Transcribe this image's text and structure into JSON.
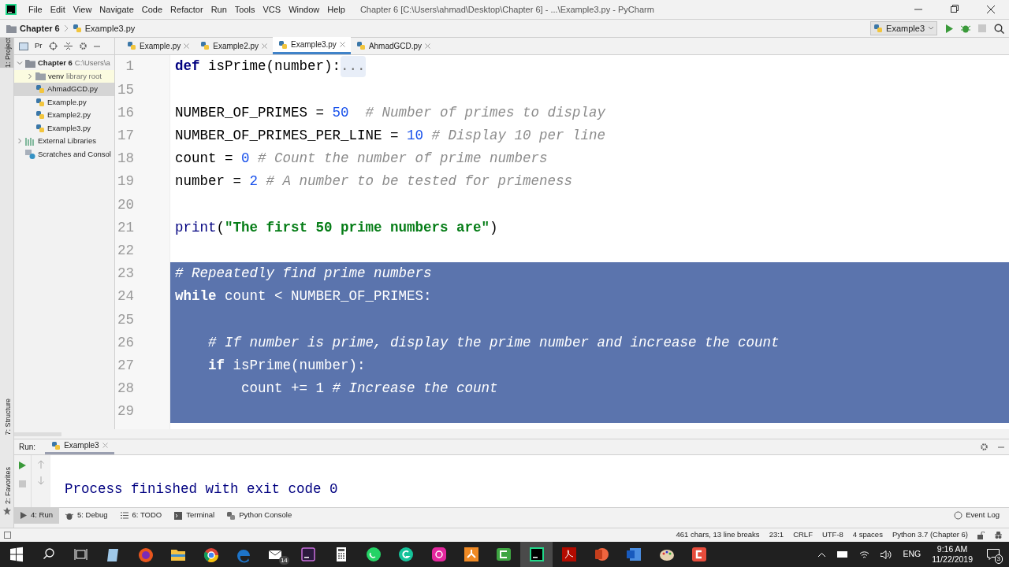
{
  "window": {
    "title": "Chapter 6 [C:\\Users\\ahmad\\Desktop\\Chapter 6] - ...\\Example3.py - PyCharm",
    "menu": [
      "File",
      "Edit",
      "View",
      "Navigate",
      "Code",
      "Refactor",
      "Run",
      "Tools",
      "VCS",
      "Window",
      "Help"
    ]
  },
  "breadcrumb": [
    "Chapter 6",
    "Example3.py"
  ],
  "run_config": "Example3",
  "side_strip": [
    {
      "label": "1: Project",
      "selected": true
    },
    {
      "label": "7: Structure",
      "selected": false
    },
    {
      "label": "2: Favorites",
      "selected": false
    }
  ],
  "project_panel": {
    "header": "Pr",
    "tree": [
      {
        "label": "Chapter 6",
        "hint": "C:\\Users\\a",
        "kind": "folder",
        "expanded": true,
        "selected": false,
        "children": [
          {
            "label": "venv",
            "hint": "library root",
            "kind": "venv",
            "expanded": false,
            "selected": false
          },
          {
            "label": "AhmadGCD.py",
            "kind": "file",
            "selected": true
          },
          {
            "label": "Example.py",
            "kind": "file",
            "selected": false
          },
          {
            "label": "Example2.py",
            "kind": "file",
            "selected": false
          },
          {
            "label": "Example3.py",
            "kind": "file",
            "selected": false
          }
        ]
      },
      {
        "label": "External Libraries",
        "kind": "libraries",
        "expanded": false,
        "selected": false
      },
      {
        "label": "Scratches and Consol",
        "kind": "scratches",
        "selected": false
      }
    ]
  },
  "editor_tabs": [
    {
      "label": "Example.py",
      "selected": false
    },
    {
      "label": "Example2.py",
      "selected": false
    },
    {
      "label": "Example3.py",
      "selected": true
    },
    {
      "label": "AhmadGCD.py",
      "selected": false
    }
  ],
  "editor_lines": [
    {
      "number": "1",
      "selected": false,
      "tokens": [
        {
          "kind": "keyword",
          "text": "def"
        },
        {
          "kind": "plain",
          "text": " isPrime(number):"
        },
        {
          "kind": "fold",
          "text": "..."
        }
      ]
    },
    {
      "number": "15",
      "selected": false
    },
    {
      "number": "16",
      "selected": false,
      "tokens": [
        {
          "kind": "plain",
          "text": "NUMBER_OF_PRIMES = "
        },
        {
          "kind": "number",
          "text": "50"
        },
        {
          "kind": "comment",
          "text": "  # Number of primes to display"
        }
      ]
    },
    {
      "number": "17",
      "selected": false,
      "tokens": [
        {
          "kind": "plain",
          "text": "NUMBER_OF_PRIMES_PER_LINE = "
        },
        {
          "kind": "number",
          "text": "10"
        },
        {
          "kind": "comment",
          "text": " # Display 10 per line"
        }
      ]
    },
    {
      "number": "18",
      "selected": false,
      "tokens": [
        {
          "kind": "plain",
          "text": "count = "
        },
        {
          "kind": "number",
          "text": "0"
        },
        {
          "kind": "comment",
          "text": " # Count the number of prime numbers"
        }
      ]
    },
    {
      "number": "19",
      "selected": false,
      "tokens": [
        {
          "kind": "plain",
          "text": "number = "
        },
        {
          "kind": "number",
          "text": "2"
        },
        {
          "kind": "comment",
          "text": " # A number to be tested for primeness"
        }
      ]
    },
    {
      "number": "20",
      "selected": false
    },
    {
      "number": "21",
      "selected": false,
      "tokens": [
        {
          "kind": "builtin",
          "text": "print"
        },
        {
          "kind": "plain",
          "text": "("
        },
        {
          "kind": "string",
          "text": "\"The first 50 prime numbers are\""
        },
        {
          "kind": "plain",
          "text": ")"
        }
      ]
    },
    {
      "number": "22",
      "selected": false
    },
    {
      "number": "23",
      "selected": true,
      "tokens": [
        {
          "kind": "comment",
          "text": "# Repeatedly find prime numbers"
        }
      ]
    },
    {
      "number": "24",
      "selected": true,
      "tokens": [
        {
          "kind": "keyword",
          "text": "while"
        },
        {
          "kind": "plain",
          "text": " count < NUMBER_OF_PRIMES:"
        }
      ]
    },
    {
      "number": "25",
      "selected": true
    },
    {
      "number": "26",
      "selected": true,
      "tokens": [
        {
          "kind": "comment",
          "text": "    # If number is prime, display the prime number and increase the count"
        }
      ]
    },
    {
      "number": "27",
      "selected": true,
      "tokens": [
        {
          "kind": "keyword",
          "text": "    if"
        },
        {
          "kind": "plain",
          "text": " isPrime(number):"
        }
      ]
    },
    {
      "number": "28",
      "selected": true,
      "tokens": [
        {
          "kind": "plain",
          "text": "        count += "
        },
        {
          "kind": "number",
          "text": "1"
        },
        {
          "kind": "comment",
          "text": " # Increase the count"
        }
      ]
    },
    {
      "number": "29",
      "selected": true
    }
  ],
  "run_panel": {
    "label": "Run:",
    "tab": "Example3",
    "output": "Process finished with exit code 0"
  },
  "tool_windows": [
    {
      "label": "4: Run",
      "kind": "run",
      "selected": true
    },
    {
      "label": "5: Debug",
      "kind": "debug",
      "selected": false
    },
    {
      "label": "6: TODO",
      "kind": "todo",
      "selected": false
    },
    {
      "label": "Terminal",
      "kind": "terminal",
      "selected": false
    },
    {
      "label": "Python Console",
      "kind": "console",
      "selected": false
    }
  ],
  "event_log": "Event Log",
  "status_bar": [
    "461 chars, 13 line breaks",
    "23:1",
    "CRLF",
    "UTF-8",
    "4 spaces",
    "Python 3.7 (Chapter 6)"
  ],
  "taskbar": {
    "apps": [
      {
        "selected": false
      },
      {
        "selected": false
      },
      {
        "selected": false
      },
      {
        "selected": false
      },
      {
        "selected": false
      },
      {
        "selected": false,
        "badge": "14"
      },
      {
        "selected": false
      },
      {
        "selected": false
      },
      {
        "selected": false
      },
      {
        "selected": false
      },
      {
        "selected": false
      },
      {
        "selected": false
      },
      {
        "selected": false
      },
      {
        "selected": true
      },
      {
        "selected": false
      },
      {
        "selected": false
      },
      {
        "selected": false
      },
      {
        "selected": false
      },
      {
        "selected": false
      }
    ],
    "language": "ENG",
    "time": "9:16 AM",
    "date": "11/22/2019",
    "notifications": "3"
  }
}
